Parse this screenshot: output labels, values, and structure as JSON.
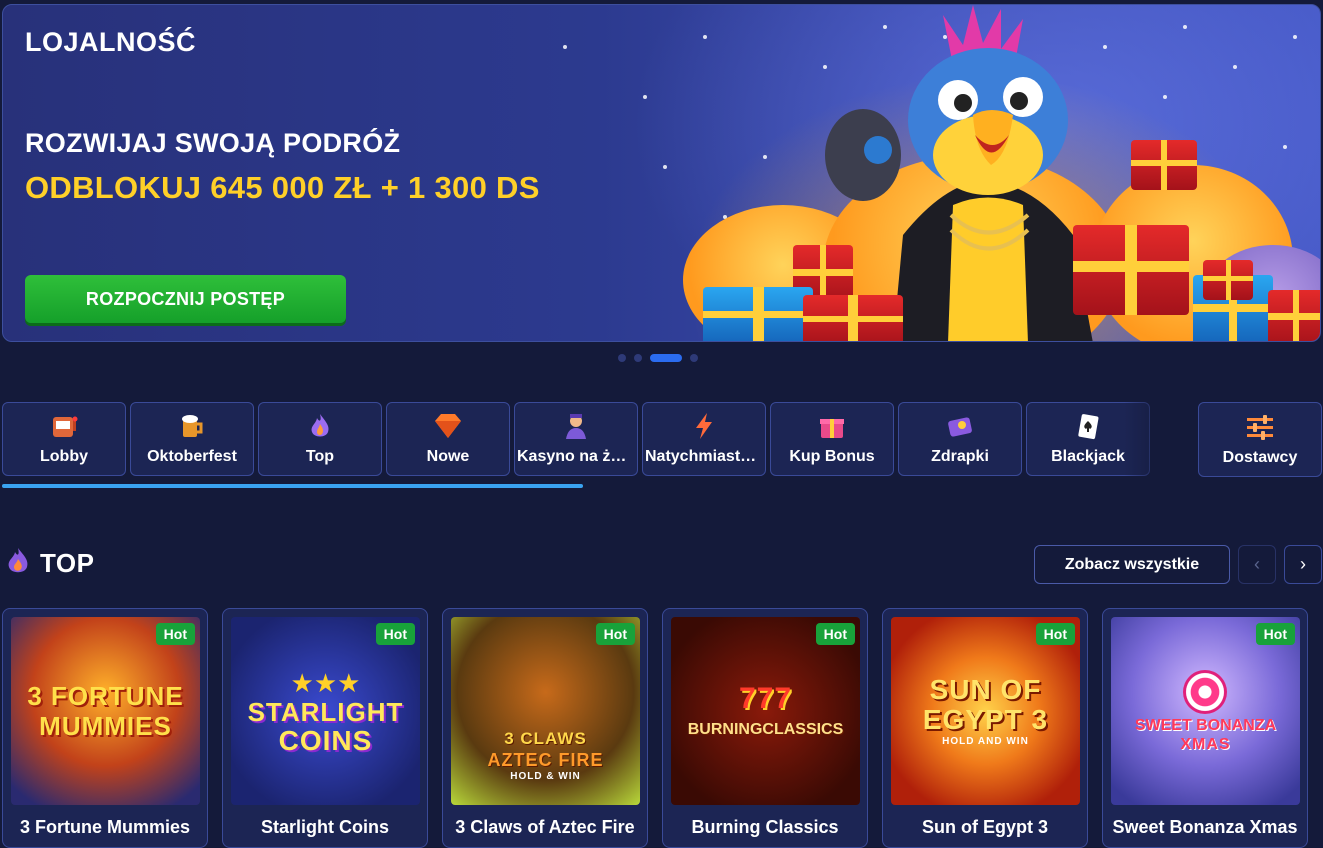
{
  "hero": {
    "label": "LOJALNOŚĆ",
    "title": "ROZWIJAJ SWOJĄ PODRÓŻ",
    "subtitle": "ODBLOKUJ 645 000 ZŁ + 1 300 DS",
    "cta": "ROZPOCZNIJ POSTĘP",
    "accent_color": "#ffd028",
    "cta_color": "#1fae32"
  },
  "carousel": {
    "pages": 4,
    "active": 3
  },
  "categories": [
    {
      "label": "Lobby",
      "icon": "slot-machine-icon"
    },
    {
      "label": "Oktoberfest",
      "icon": "beer-mug-icon"
    },
    {
      "label": "Top",
      "icon": "flame-icon"
    },
    {
      "label": "Nowe",
      "icon": "diamond-icon"
    },
    {
      "label": "Kasyno na żywo",
      "icon": "dealer-icon"
    },
    {
      "label": "Natychmiastowe",
      "icon": "lightning-icon"
    },
    {
      "label": "Kup Bonus",
      "icon": "gift-icon"
    },
    {
      "label": "Zdrapki",
      "icon": "scratch-card-icon"
    },
    {
      "label": "Blackjack",
      "icon": "card-icon"
    }
  ],
  "providers": {
    "label": "Dostawcy",
    "icon": "sliders-icon"
  },
  "section": {
    "title": "TOP",
    "icon": "flame-icon",
    "see_all": "Zobacz wszystkie"
  },
  "games": [
    {
      "name": "3 Fortune Mummies",
      "badge": "Hot",
      "art": [
        "3 FORTUNE",
        "MUMMIES"
      ]
    },
    {
      "name": "Starlight Coins",
      "badge": "Hot",
      "art": [
        "STARLIGHT",
        "COINS"
      ]
    },
    {
      "name": "3 Claws of Aztec Fire",
      "badge": "Hot",
      "art": [
        "3 CLAWS",
        "AZTEC FIRE",
        "HOLD & WIN"
      ]
    },
    {
      "name": "Burning Classics",
      "badge": "Hot",
      "art": [
        "777",
        "BURNINGCLASSICS"
      ]
    },
    {
      "name": "Sun of Egypt 3",
      "badge": "Hot",
      "art": [
        "SUN OF",
        "EGYPT 3",
        "HOLD AND WIN"
      ]
    },
    {
      "name": "Sweet Bonanza Xmas",
      "badge": "Hot",
      "art": [
        "SWEET BONANZA",
        "XMAS"
      ]
    }
  ]
}
